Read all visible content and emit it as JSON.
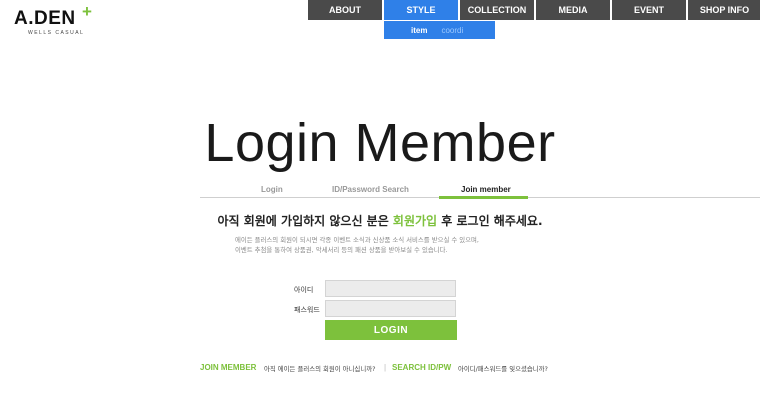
{
  "logo": {
    "brand": "A.DEN",
    "plus": "+",
    "subtitle": "WELLS CASUAL"
  },
  "nav": {
    "items": [
      "ABOUT",
      "STYLE",
      "COLLECTION",
      "MEDIA",
      "EVENT",
      "SHOP INFO"
    ],
    "active": "STYLE",
    "submenu": [
      "item",
      "coordi"
    ]
  },
  "page": {
    "title": "Login Member"
  },
  "tabs": {
    "login": "Login",
    "id_pw_search": "ID/Password Search",
    "join_member": "Join member",
    "active": "Join member"
  },
  "message": {
    "headline_before": "아직 회원에 가입하지 않으신 분은 ",
    "headline_highlight": "회원가입",
    "headline_after": " 후 로그인 해주세요.",
    "line1": "에이든 플러스의 회원이 되시면 각종 이벤트 소식과 신상품 소식 서비스를 받으실 수 있으며,",
    "line2": "이벤트 추첨을 통하여 상품권, 악세서리 등의 패션 상품을 받아보실 수 있습니다."
  },
  "form": {
    "id_label": "아이디",
    "pw_label": "패스워드",
    "id_value": "",
    "pw_value": "",
    "login_button": "LOGIN"
  },
  "bottom": {
    "join_link": "JOIN MEMBER",
    "join_desc": "아직 에이든 플러스의 회원이 아니십니까?",
    "separator": "|",
    "search_link": "SEARCH ID/PW",
    "search_desc": "아이디/패스워드를 잊으셨습니까?"
  },
  "colors": {
    "accent_green": "#7dc13c",
    "nav_blue": "#2f80e8",
    "nav_dark": "#4a4a4a"
  }
}
